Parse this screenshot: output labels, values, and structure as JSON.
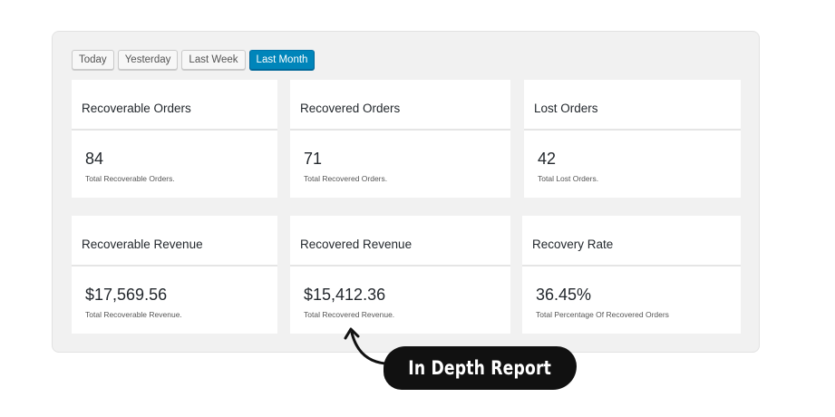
{
  "range_tabs": [
    "Today",
    "Yesterday",
    "Last Week",
    "Last Month"
  ],
  "active_tab": "Last Month",
  "cards": [
    {
      "title": "Recoverable Orders",
      "value": "84",
      "description": "Total Recoverable Orders."
    },
    {
      "title": "Recovered Orders",
      "value": "71",
      "description": "Total Recovered Orders."
    },
    {
      "title": "Lost Orders",
      "value": "42",
      "description": "Total Lost Orders."
    },
    {
      "title": "Recoverable Revenue",
      "value": "$17,569.56",
      "description": "Total Recoverable Revenue."
    },
    {
      "title": "Recovered Revenue",
      "value": "$15,412.36",
      "description": "Total Recovered Revenue."
    },
    {
      "title": "Recovery Rate",
      "value": "36.45%",
      "description": "Total Percentage Of Recovered Orders"
    }
  ],
  "callout": {
    "label": "In Depth Report"
  },
  "colors": {
    "accent": "#0085ba",
    "panel_bg": "#f1f1f1",
    "callout_bg": "#111111"
  },
  "icons": {
    "callout_arrow": "curved-arrow-icon"
  }
}
